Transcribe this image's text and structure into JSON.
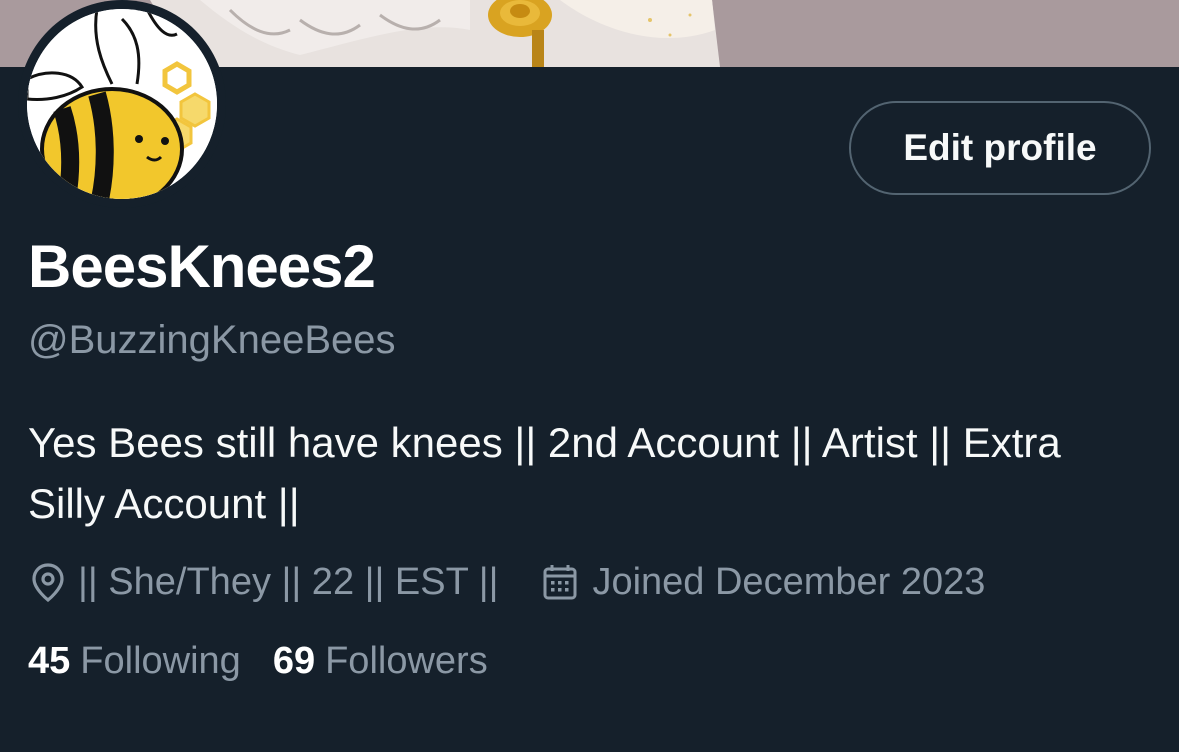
{
  "profile": {
    "display_name": "BeesKnees2",
    "handle": "@BuzzingKneeBees",
    "bio": "Yes Bees still have knees || 2nd Account || Artist || Extra Silly Account ||",
    "location": "|| She/They || 22 || EST ||",
    "joined": "Joined December 2023",
    "edit_button_label": "Edit profile"
  },
  "stats": {
    "following_count": "45",
    "following_label": "Following",
    "followers_count": "69",
    "followers_label": "Followers"
  },
  "icons": {
    "location": "location-pin-icon",
    "joined": "calendar-icon"
  },
  "colors": {
    "background": "#15202b",
    "secondary_text": "#8b98a5",
    "primary_text": "#ffffff",
    "button_border": "#536471"
  }
}
